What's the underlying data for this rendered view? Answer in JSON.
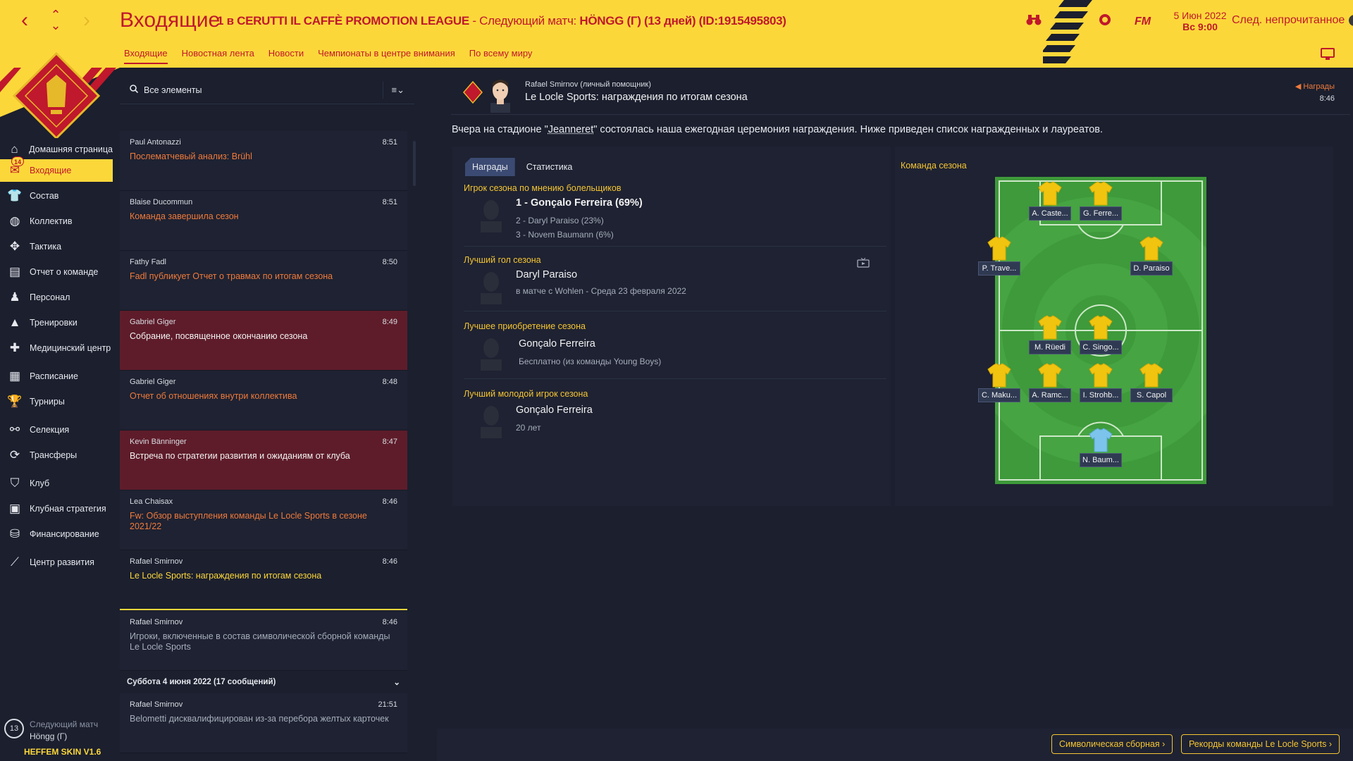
{
  "header": {
    "title": "Входящие",
    "competition": "1 в CERUTTI IL CAFFÈ PROMOTION LEAGUE",
    "next_match_prefix": " - Следующий матч: ",
    "next_match_value": "HÖNGG (Г) (13 дней) (ID:1915495803)",
    "fm_label": "FM",
    "date": "5 Июн 2022",
    "day_time": "Вс 9:00",
    "next_unread": "След. непрочитанное",
    "colors": {
      "accent": "#fcd73a",
      "brand_red": "#c0182c"
    }
  },
  "tabs": [
    "Входящие",
    "Новостная лента",
    "Новости",
    "Чемпионаты в центре внимания",
    "По всему миру"
  ],
  "sidebar": {
    "inbox_badge": "14",
    "items": [
      {
        "label": "Домашняя страница",
        "icon": "home-icon"
      },
      {
        "label": "Входящие",
        "icon": "inbox-icon"
      },
      {
        "label": "Состав",
        "icon": "shirt-icon"
      },
      {
        "label": "Коллектив",
        "icon": "dynamics-icon"
      },
      {
        "label": "Тактика",
        "icon": "tactics-icon"
      },
      {
        "label": "Отчет о команде",
        "icon": "report-icon"
      },
      {
        "label": "Персонал",
        "icon": "staff-icon"
      },
      {
        "label": "Тренировки",
        "icon": "cone-icon"
      },
      {
        "label": "Медицинский центр",
        "icon": "medical-icon"
      },
      {
        "label": "Расписание",
        "icon": "calendar-icon"
      },
      {
        "label": "Турниры",
        "icon": "trophy-icon"
      },
      {
        "label": "Селекция",
        "icon": "binoculars-icon"
      },
      {
        "label": "Трансферы",
        "icon": "transfer-icon"
      },
      {
        "label": "Клуб",
        "icon": "club-icon"
      },
      {
        "label": "Клубная стратегия",
        "icon": "strategy-icon"
      },
      {
        "label": "Финансирование",
        "icon": "finance-icon"
      },
      {
        "label": "Центр развития",
        "icon": "development-icon"
      }
    ],
    "next_match_label": "Следующий матч",
    "next_match_team": "Höngg (Г)",
    "next_match_days": "13",
    "skin": "HEFFEM SKIN V1.6"
  },
  "inbox": {
    "search_placeholder": "Все элементы",
    "messages": [
      {
        "from": "Paul Antonazzi",
        "time": "8:51",
        "subject": "Послематчевый анализ: Brühl",
        "style": "normal"
      },
      {
        "from": "Blaise Ducommun",
        "time": "8:51",
        "subject": "Команда завершила сезон",
        "style": "normal"
      },
      {
        "from": "Fathy Fadl",
        "time": "8:50",
        "subject": "Fadl публикует Отчет о травмах по итогам сезона",
        "style": "normal"
      },
      {
        "from": "Gabriel Giger",
        "time": "8:49",
        "subject": "Собрание, посвященное окончанию сезона",
        "style": "red"
      },
      {
        "from": "Gabriel Giger",
        "time": "8:48",
        "subject": "Отчет об отношениях внутри коллектива",
        "style": "normal"
      },
      {
        "from": "Kevin Bänninger",
        "time": "8:47",
        "subject": "Встреча по стратегии развития и ожиданиям от клуба",
        "style": "red"
      },
      {
        "from": "Lea Chaisax",
        "time": "8:46",
        "subject": "Fw: Обзор выступления команды Le Locle Sports в сезоне 2021/22",
        "style": "normal"
      },
      {
        "from": "Rafael Smirnov",
        "time": "8:46",
        "subject": "Le Locle Sports: награждения по итогам сезона",
        "style": "selected"
      },
      {
        "from": "Rafael Smirnov",
        "time": "8:46",
        "subject": "Игроки, включенные в состав символической сборной команды Le Locle Sports",
        "style": "read"
      }
    ],
    "day_separator": "Суббота 4 июня 2022 (17 сообщений)",
    "older_messages": [
      {
        "from": "Rafael Smirnov",
        "time": "21:51",
        "subject": "Belometti дисквалифицирован из-за перебора желтых карточек",
        "style": "read"
      }
    ]
  },
  "message": {
    "sender": "Rafael Smirnov  (личный помощник)",
    "title": "Le Locle Sports: награждения по итогам сезона",
    "tag": "Награды",
    "time": "8:46",
    "intro_before": "Вчера на стадионе \"",
    "intro_stadium": "Jeanneret",
    "intro_after": "\" состоялась наша ежегодная церемония награждения. Ниже приведен список награжденных и лауреатов.",
    "panel_tabs": [
      "Награды",
      "Статистика"
    ],
    "awards": {
      "fans_player": {
        "category": "Игрок сезона по мнению болельщиков",
        "first": "1 - Gonçalo Ferreira (69%)",
        "second": "2 - Daryl Paraiso (23%)",
        "third": "3 - Novem Baumann (6%)"
      },
      "goal": {
        "category": "Лучший гол сезона",
        "player": "Daryl Paraiso",
        "detail": "в матче с Wohlen - Среда 23 февраля 2022"
      },
      "signing": {
        "category": "Лучшее приобретение сезона",
        "player": "Gonçalo Ferreira",
        "detail": "Бесплатно (из команды Young Boys)"
      },
      "young": {
        "category": "Лучший молодой игрок сезона",
        "player": "Gonçalo Ferreira",
        "detail": "20 лет"
      }
    },
    "team_of_season": {
      "title": "Команда сезона",
      "players": [
        {
          "name": "A. Caste..."
        },
        {
          "name": "G. Ferre..."
        },
        {
          "name": "P. Trave..."
        },
        {
          "name": "D. Paraiso"
        },
        {
          "name": "M. Rüedi"
        },
        {
          "name": "C. Singo..."
        },
        {
          "name": "C. Maku..."
        },
        {
          "name": "A. Ramc..."
        },
        {
          "name": "I. Strohb..."
        },
        {
          "name": "S. Capol"
        },
        {
          "name": "N. Baum..."
        }
      ]
    }
  },
  "footer": {
    "best_xi_button": "Символическая сборная",
    "records_button": "Рекорды команды Le Locle Sports"
  }
}
